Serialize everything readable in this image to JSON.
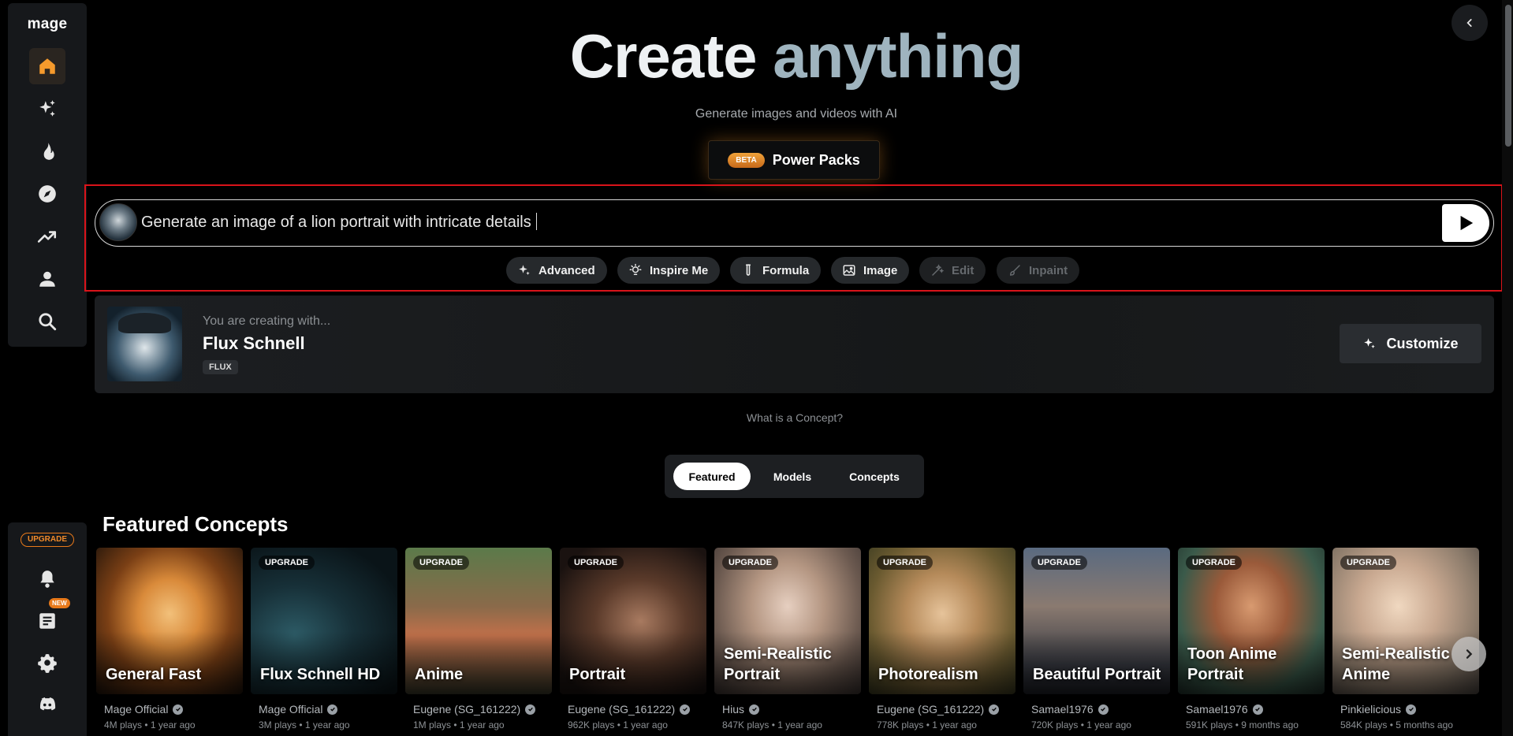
{
  "sidebar": {
    "brand": "mage",
    "items": [
      {
        "name": "home-icon",
        "active": true
      },
      {
        "name": "sparkles-icon"
      },
      {
        "name": "flame-icon"
      },
      {
        "name": "compass-icon"
      },
      {
        "name": "trending-icon"
      },
      {
        "name": "user-icon"
      },
      {
        "name": "search-icon"
      }
    ],
    "upgrade_label": "UPGRADE",
    "new_badge": "NEW"
  },
  "hero": {
    "title_word1": "Create",
    "title_word2": "anything",
    "subtitle": "Generate images and videos with AI",
    "beta_label": "BETA",
    "power_packs_label": "Power Packs"
  },
  "prompt": {
    "text": "Generate an image of a lion portrait with intricate details",
    "chips": {
      "advanced": "Advanced",
      "inspire": "Inspire Me",
      "formula": "Formula",
      "image": "Image",
      "edit": "Edit",
      "inpaint": "Inpaint"
    }
  },
  "creating": {
    "label": "You are creating with...",
    "model_name": "Flux Schnell",
    "tag": "FLUX",
    "customize_label": "Customize"
  },
  "concept_link": "What is a Concept?",
  "tabs": {
    "featured": "Featured",
    "models": "Models",
    "concepts": "Concepts"
  },
  "section_title": "Featured Concepts",
  "cards": [
    {
      "name": "General Fast",
      "upgrade": "",
      "author": "Mage Official",
      "stats": "4M plays • 1 year ago"
    },
    {
      "name": "Flux Schnell HD",
      "upgrade": "UPGRADE",
      "author": "Mage Official",
      "stats": "3M plays • 1 year ago"
    },
    {
      "name": "Anime",
      "upgrade": "UPGRADE",
      "author": "Eugene (SG_161222)",
      "stats": "1M plays • 1 year ago"
    },
    {
      "name": "Portrait",
      "upgrade": "UPGRADE",
      "author": "Eugene (SG_161222)",
      "stats": "962K plays • 1 year ago"
    },
    {
      "name": "Semi-Realistic Portrait",
      "upgrade": "UPGRADE",
      "author": "Hius",
      "stats": "847K plays • 1 year ago"
    },
    {
      "name": "Photorealism",
      "upgrade": "UPGRADE",
      "author": "Eugene (SG_161222)",
      "stats": "778K plays • 1 year ago"
    },
    {
      "name": "Beautiful Portrait",
      "upgrade": "UPGRADE",
      "author": "Samael1976",
      "stats": "720K plays • 1 year ago"
    },
    {
      "name": "Toon Anime Portrait",
      "upgrade": "UPGRADE",
      "author": "Samael1976",
      "stats": "591K plays • 9 months ago"
    },
    {
      "name": "Semi-Realistic Anime",
      "upgrade": "UPGRADE",
      "author": "Pinkielicious",
      "stats": "584K plays • 5 months ago"
    }
  ],
  "colors": {
    "accent": "#e8791a",
    "highlight_frame": "#d9131a",
    "title_gradient": "#9fb4bf"
  }
}
